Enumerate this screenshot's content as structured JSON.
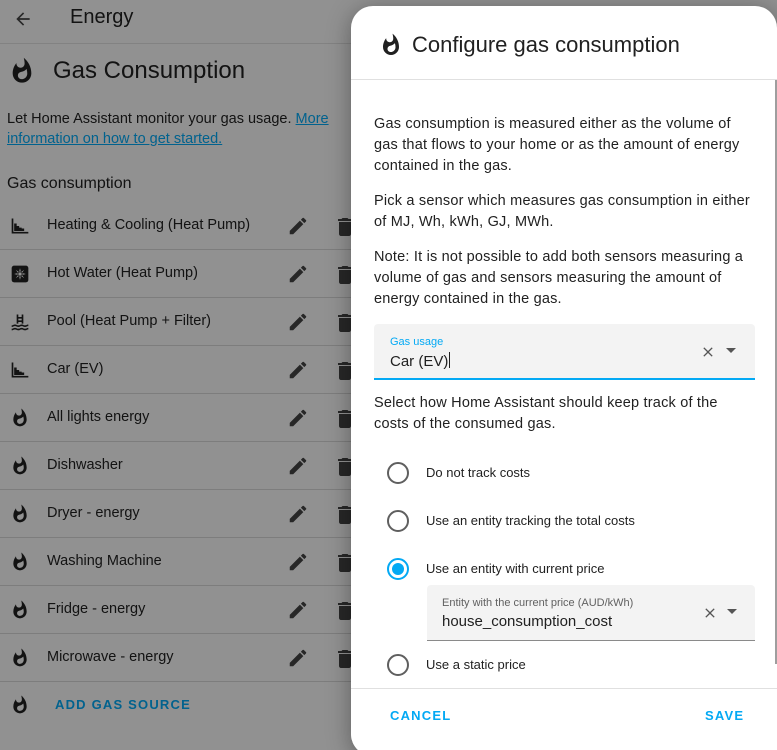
{
  "topbar": {
    "title": "Energy"
  },
  "section": {
    "title": "Gas Consumption",
    "description": "Let Home Assistant monitor your gas usage. ",
    "link": "More information on how to get started.",
    "list_title": "Gas consumption"
  },
  "sources": [
    {
      "label": "Heating & Cooling (Heat Pump)",
      "icon": "chart-step-icon"
    },
    {
      "label": "Hot Water (Heat Pump)",
      "icon": "heat-pump-icon"
    },
    {
      "label": "Pool (Heat Pump + Filter)",
      "icon": "pool-icon"
    },
    {
      "label": "Car (EV)",
      "icon": "chart-step-icon"
    },
    {
      "label": "All lights energy",
      "icon": "fire-icon"
    },
    {
      "label": "Dishwasher",
      "icon": "fire-icon"
    },
    {
      "label": "Dryer - energy",
      "icon": "fire-icon"
    },
    {
      "label": "Washing Machine",
      "icon": "fire-icon"
    },
    {
      "label": "Fridge - energy",
      "icon": "fire-icon"
    },
    {
      "label": "Microwave - energy",
      "icon": "fire-icon"
    }
  ],
  "add_button": "ADD GAS SOURCE",
  "dialog": {
    "title": "Configure gas consumption",
    "para1": "Gas consumption is measured either as the volume of gas that flows to your home or as the amount of energy contained in the gas.",
    "para2": "Pick a sensor which measures gas consumption in either of MJ, Wh, kWh, GJ, MWh.",
    "para3": "Note: It is not possible to add both sensors measuring a volume of gas and sensors measuring the amount of energy contained in the gas.",
    "gas_usage": {
      "label": "Gas usage",
      "value": "Car (EV)"
    },
    "para4": "Select how Home Assistant should keep track of the costs of the consumed gas.",
    "options": [
      {
        "label": "Do not track costs",
        "checked": false
      },
      {
        "label": "Use an entity tracking the total costs",
        "checked": false
      },
      {
        "label": "Use an entity with current price",
        "checked": true
      },
      {
        "label": "Use a static price",
        "checked": false
      }
    ],
    "price_entity": {
      "label": "Entity with the current price (AUD/kWh)",
      "value": "house_consumption_cost"
    },
    "cancel": "CANCEL",
    "save": "SAVE"
  },
  "colors": {
    "accent": "#03a9f4",
    "scrim": "rgba(0,0,0,0.42)"
  }
}
